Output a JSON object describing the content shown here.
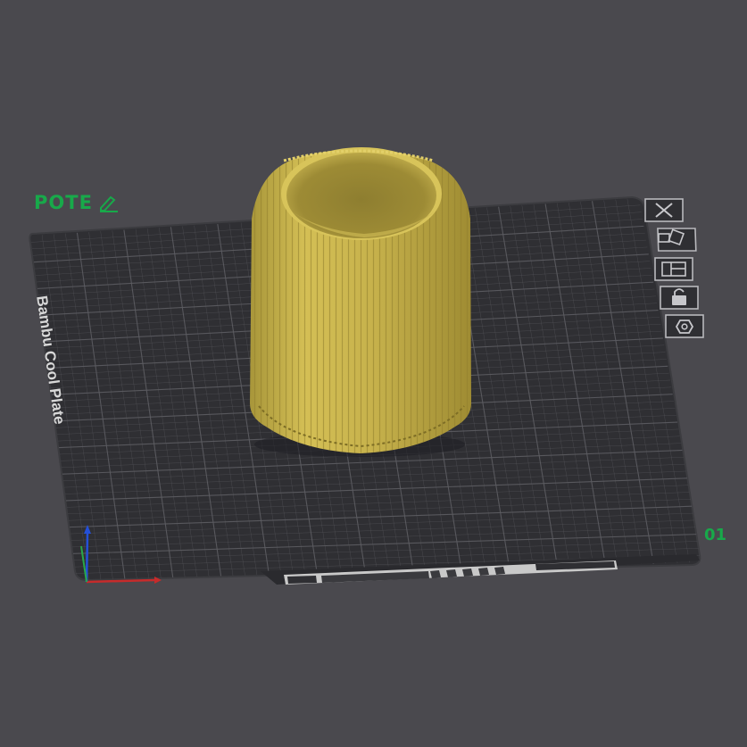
{
  "plate": {
    "name": "POTE",
    "index": "01",
    "bed_label": "Bambu Cool Plate"
  },
  "toolbar": {
    "buttons": [
      {
        "name": "close-plate-button",
        "icon": "close-icon"
      },
      {
        "name": "auto-orient-button",
        "icon": "orient-icon"
      },
      {
        "name": "arrange-button",
        "icon": "arrange-icon"
      },
      {
        "name": "lock-button",
        "icon": "lock-icon"
      },
      {
        "name": "plate-settings-button",
        "icon": "gear-icon"
      }
    ]
  },
  "colors": {
    "background": "#4a494e",
    "plate": "#2f2f33",
    "grid": "#5d5d62",
    "model": "#c9b54e",
    "accent": "#18a94a"
  }
}
